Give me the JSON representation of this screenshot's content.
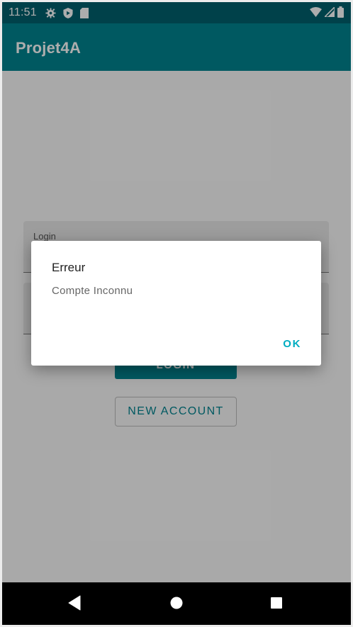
{
  "status_bar": {
    "time": "11:51",
    "left_icons": [
      "settings-icon",
      "shield-icon",
      "sd-card-icon"
    ],
    "right_icons": [
      "wifi-icon",
      "signal-icon",
      "battery-icon"
    ]
  },
  "app_bar": {
    "title": "Projet4A"
  },
  "form": {
    "login_hint": "Login",
    "login_button": "LOGIN",
    "new_account_button": "NEW ACCOUNT"
  },
  "dialog": {
    "title": "Erreur",
    "message": "Compte Inconnu",
    "ok_label": "OK"
  },
  "nav_bar": {
    "buttons": [
      "back-icon",
      "home-icon",
      "recents-icon"
    ]
  },
  "colors": {
    "primary": "#00838f",
    "primary_dark": "#00606d",
    "accent": "#00acc1"
  }
}
